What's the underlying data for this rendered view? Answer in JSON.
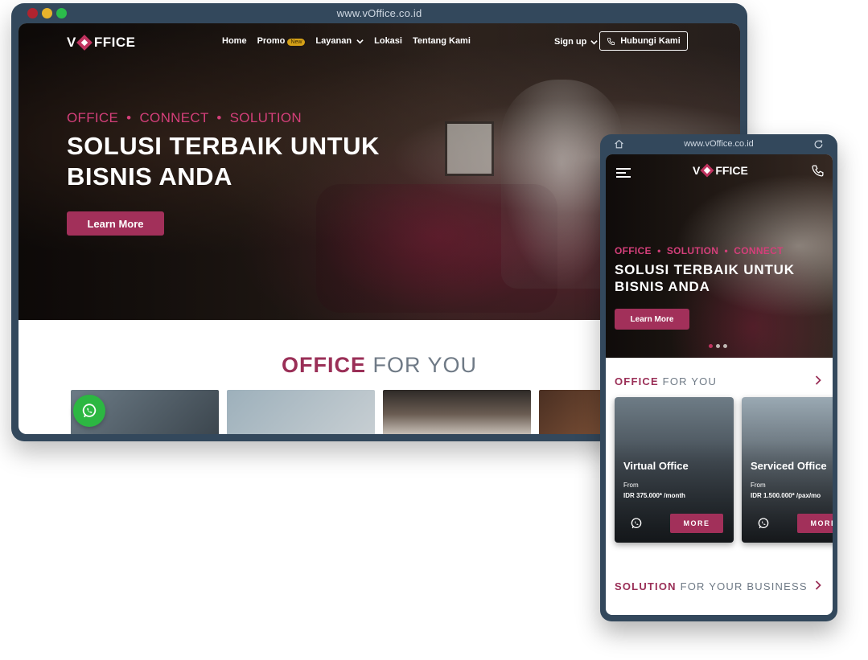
{
  "desktop": {
    "url": "www.vOffice.co.id",
    "logo_text": [
      "V",
      "FFICE"
    ],
    "nav": {
      "home": "Home",
      "promo": "Promo",
      "promo_badge": "New",
      "layanan": "Layanan",
      "lokasi": "Lokasi",
      "tentang": "Tentang Kami",
      "signup": "Sign up",
      "hubungi": "Hubungi Kami"
    },
    "hero": {
      "tagline": "OFFICE  •  CONNECT  •  SOLUTION",
      "title": "SOLUSI TERBAIK UNTUK BISNIS ANDA",
      "cta": "Learn More"
    },
    "section": {
      "accent": "OFFICE",
      "rest": " FOR YOU"
    }
  },
  "mobile": {
    "url": "www.vOffice.co.id",
    "logo_text": [
      "V",
      "FFICE"
    ],
    "hero": {
      "tagline": "OFFICE  •  SOLUTION  •  CONNECT",
      "title": "SOLUSI TERBAIK UNTUK BISNIS ANDA",
      "cta": "Learn More"
    },
    "office_section": {
      "accent": "OFFICE",
      "rest": " FOR YOU"
    },
    "cards": [
      {
        "title": "Virtual Office",
        "from": "From",
        "price": "IDR 375.000* /month",
        "more": "MORE"
      },
      {
        "title": "Serviced Office",
        "from": "From",
        "price": "IDR 1.500.000* /pax/mo",
        "more": "MORE"
      }
    ],
    "solution_section": {
      "accent": "SOLUTION",
      "rest": " FOR YOUR BUSINESS"
    }
  },
  "colors": {
    "brand": "#a2305a",
    "brand_pink": "#d43f7a",
    "frame": "#33485c",
    "whatsapp": "#2cb742"
  }
}
